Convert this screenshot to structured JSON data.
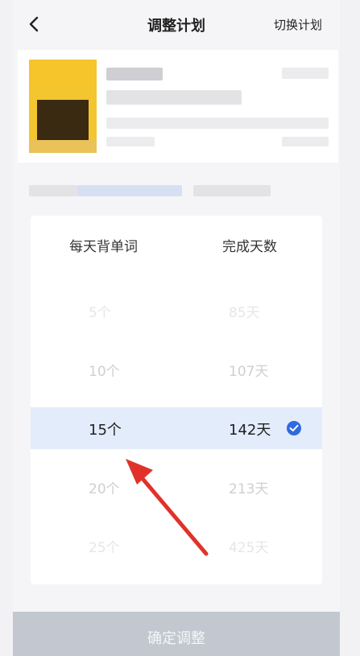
{
  "nav": {
    "title": "调整计划",
    "switch_label": "切换计划"
  },
  "picker": {
    "header_left": "每天背单词",
    "header_right": "完成天数",
    "rows": [
      {
        "words": "5个",
        "days": "85天"
      },
      {
        "words": "10个",
        "days": "107天"
      },
      {
        "words": "15个",
        "days": "142天"
      },
      {
        "words": "20个",
        "days": "213天"
      },
      {
        "words": "25个",
        "days": "425天"
      }
    ],
    "selected_index": 2
  },
  "footer": {
    "confirm_label": "确定调整"
  },
  "colors": {
    "accent": "#2f6bde",
    "selected_row_bg": "#e3ecfb",
    "annotation_arrow": "#e0322b",
    "confirm_disabled_bg": "#c3c8d0"
  },
  "icons": {
    "back": "chevron-left-icon",
    "selected": "check-circle-icon"
  }
}
